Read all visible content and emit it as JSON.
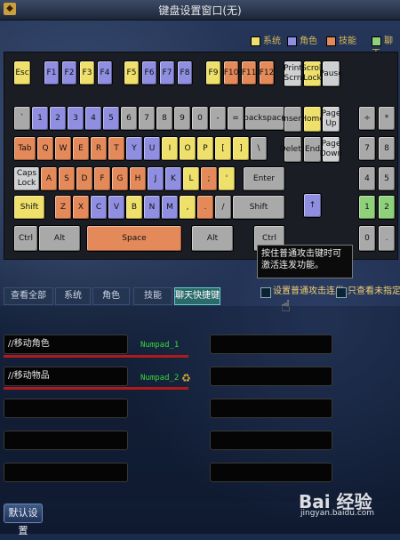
{
  "window": {
    "title": "键盘设置窗口(无)"
  },
  "legend": [
    {
      "label": "系统",
      "color": "#eee06a"
    },
    {
      "label": "角色",
      "color": "#8f8ee0"
    },
    {
      "label": "技能",
      "color": "#e48a5a"
    },
    {
      "label": "聊天",
      "color": "#8fd07a"
    }
  ],
  "keyboard": {
    "keys": [
      {
        "label": "Esc",
        "color": "yellow"
      },
      {
        "label": "F1",
        "color": "blue"
      },
      {
        "label": "F2",
        "color": "blue"
      },
      {
        "label": "F3",
        "color": "yellow"
      },
      {
        "label": "F4",
        "color": "blue"
      },
      {
        "label": "F5",
        "color": "yellow"
      },
      {
        "label": "F6",
        "color": "blue"
      },
      {
        "label": "F7",
        "color": "blue"
      },
      {
        "label": "F8",
        "color": "blue"
      },
      {
        "label": "F9",
        "color": "yellow"
      },
      {
        "label": "F10",
        "color": "orange"
      },
      {
        "label": "F11",
        "color": "orange"
      },
      {
        "label": "F12",
        "color": "orange"
      },
      {
        "label": "Print Scrn",
        "color": "white"
      },
      {
        "label": "Scroll Lock",
        "color": "yellow"
      },
      {
        "label": "Pause",
        "color": "white"
      },
      {
        "label": "`",
        "color": "gray"
      },
      {
        "label": "1",
        "color": "blue"
      },
      {
        "label": "2",
        "color": "blue"
      },
      {
        "label": "3",
        "color": "blue"
      },
      {
        "label": "4",
        "color": "blue"
      },
      {
        "label": "5",
        "color": "blue"
      },
      {
        "label": "6",
        "color": "gray"
      },
      {
        "label": "7",
        "color": "gray"
      },
      {
        "label": "8",
        "color": "gray"
      },
      {
        "label": "9",
        "color": "gray"
      },
      {
        "label": "0",
        "color": "gray"
      },
      {
        "label": "-",
        "color": "gray"
      },
      {
        "label": "=",
        "color": "gray"
      },
      {
        "label": "backspace",
        "color": "gray"
      },
      {
        "label": "Insert",
        "color": "gray"
      },
      {
        "label": "Home",
        "color": "yellow"
      },
      {
        "label": "Page Up",
        "color": "white"
      },
      {
        "label": "÷",
        "color": "gray"
      },
      {
        "label": "*",
        "color": "gray"
      },
      {
        "label": "Tab",
        "color": "orange"
      },
      {
        "label": "Q",
        "color": "orange"
      },
      {
        "label": "W",
        "color": "orange"
      },
      {
        "label": "E",
        "color": "orange"
      },
      {
        "label": "R",
        "color": "orange"
      },
      {
        "label": "T",
        "color": "orange"
      },
      {
        "label": "Y",
        "color": "blue"
      },
      {
        "label": "U",
        "color": "blue"
      },
      {
        "label": "I",
        "color": "yellow"
      },
      {
        "label": "O",
        "color": "yellow"
      },
      {
        "label": "P",
        "color": "yellow"
      },
      {
        "label": "[",
        "color": "yellow"
      },
      {
        "label": "]",
        "color": "yellow"
      },
      {
        "label": "\\",
        "color": "gray"
      },
      {
        "label": "Delete",
        "color": "gray"
      },
      {
        "label": "End",
        "color": "gray"
      },
      {
        "label": "Page Down",
        "color": "white"
      },
      {
        "label": "7",
        "color": "gray"
      },
      {
        "label": "8",
        "color": "gray"
      },
      {
        "label": "Caps Lock",
        "color": "white"
      },
      {
        "label": "A",
        "color": "orange"
      },
      {
        "label": "S",
        "color": "orange"
      },
      {
        "label": "D",
        "color": "orange"
      },
      {
        "label": "F",
        "color": "orange"
      },
      {
        "label": "G",
        "color": "orange"
      },
      {
        "label": "H",
        "color": "orange"
      },
      {
        "label": "J",
        "color": "blue"
      },
      {
        "label": "K",
        "color": "blue"
      },
      {
        "label": "L",
        "color": "yellow"
      },
      {
        "label": ";",
        "color": "orange"
      },
      {
        "label": "'",
        "color": "yellow"
      },
      {
        "label": "Enter",
        "color": "gray"
      },
      {
        "label": "4",
        "color": "gray"
      },
      {
        "label": "5",
        "color": "gray"
      },
      {
        "label": "Shift",
        "color": "yellow"
      },
      {
        "label": "Z",
        "color": "orange"
      },
      {
        "label": "X",
        "color": "orange"
      },
      {
        "label": "C",
        "color": "blue"
      },
      {
        "label": "V",
        "color": "blue"
      },
      {
        "label": "B",
        "color": "yellow"
      },
      {
        "label": "N",
        "color": "blue"
      },
      {
        "label": "M",
        "color": "blue"
      },
      {
        "label": ",",
        "color": "yellow"
      },
      {
        "label": ".",
        "color": "orange"
      },
      {
        "label": "/",
        "color": "gray"
      },
      {
        "label": "Shift",
        "color": "gray"
      },
      {
        "label": "↑",
        "color": "blue"
      },
      {
        "label": "1",
        "color": "green"
      },
      {
        "label": "2",
        "color": "green"
      },
      {
        "label": "Ctrl",
        "color": "gray"
      },
      {
        "label": "Alt",
        "color": "gray"
      },
      {
        "label": "Space",
        "color": "orange"
      },
      {
        "label": "Alt",
        "color": "gray"
      },
      {
        "label": "Ctrl",
        "color": "gray"
      },
      {
        "label": "0",
        "color": "gray"
      },
      {
        "label": ".",
        "color": "gray"
      }
    ]
  },
  "tabs": [
    "查看全部",
    "系统",
    "角色",
    "技能",
    "聊天快捷键"
  ],
  "tooltip": "按住普通攻击键时可激活连发功能。",
  "options": {
    "auto_attack_label": "设置普通攻击连发",
    "show_unassigned_label": "只查看未指定的"
  },
  "bindings": [
    {
      "name": "//移动角色",
      "key": "Numpad_1"
    },
    {
      "name": "//移动物品",
      "key": "Numpad_2"
    }
  ],
  "bottom": {
    "default_label": "默认设置"
  },
  "watermark": {
    "main": "Bai 经验",
    "sub": "jingyan.baidu.com"
  }
}
